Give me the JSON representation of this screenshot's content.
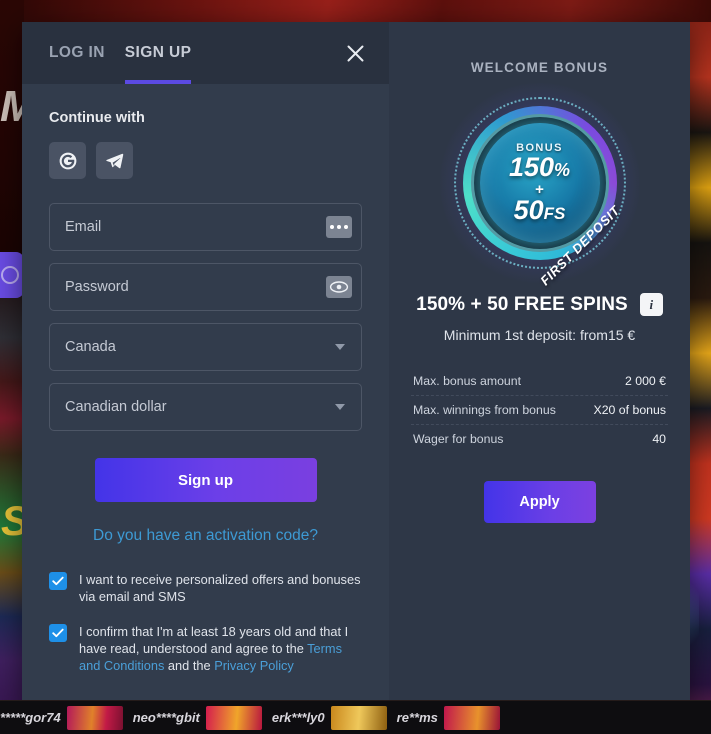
{
  "modal": {
    "tabs": [
      {
        "label": "LOG IN",
        "active": false
      },
      {
        "label": "SIGN UP",
        "active": true
      }
    ],
    "close_icon": "close-icon"
  },
  "form": {
    "continue_with_label": "Continue with",
    "social_buttons": [
      {
        "name": "google-icon",
        "label": "Google"
      },
      {
        "name": "telegram-icon",
        "label": "Telegram"
      }
    ],
    "fields": [
      {
        "name": "email-field",
        "placeholder": "Email",
        "value": "",
        "adornment": "autofill-dots-icon"
      },
      {
        "name": "password-field",
        "placeholder": "Password",
        "value": "",
        "adornment": "reveal-password-icon"
      }
    ],
    "selects": [
      {
        "name": "country-select",
        "value": "Canada"
      },
      {
        "name": "currency-select",
        "value": "Canadian dollar"
      }
    ],
    "submit_label": "Sign up",
    "activation_link": "Do you have an activation code?",
    "checkboxes": [
      {
        "checked": true,
        "text": "I want to receive personalized offers and bonuses via email and SMS"
      },
      {
        "checked": true,
        "text_part1": "I confirm that I'm at least 18 years old and that I have read, understood and agree to the ",
        "link1": "Terms and Conditions",
        "text_part2": " and the ",
        "link2": "Privacy Policy"
      }
    ]
  },
  "bonus": {
    "kicker": "WELCOME BONUS",
    "badge": {
      "bonus_word": "BONUS",
      "percent": "150",
      "percent_symbol": "%",
      "plus": "+",
      "spins": "50",
      "spins_unit": "FS",
      "ribbon": "FIRST DEPOSIT"
    },
    "title": "150% + 50 FREE SPINS",
    "info_icon_label": "i",
    "subtitle": "Minimum 1st deposit: from15 €",
    "details": [
      {
        "label": "Max. bonus amount",
        "value": "2 000 €"
      },
      {
        "label": "Max. winnings from bonus",
        "value": "X20 of bonus"
      },
      {
        "label": "Wager for bonus",
        "value": "40"
      }
    ],
    "apply_label": "Apply"
  },
  "background": {
    "brand_mark_left": "M",
    "brand_mark_lower": "S",
    "ticker": [
      {
        "name": "*****gor74"
      },
      {
        "name": "neo****gbit"
      },
      {
        "name": "erk***ly0"
      },
      {
        "name": "re**ms"
      }
    ]
  },
  "colors": {
    "accent_purple": "#5b4ae2",
    "button_gradient_start": "#4334e8",
    "button_gradient_end": "#7a3fe0",
    "checkbox_blue": "#1e90e8",
    "link_blue": "#3d9ad4",
    "panel_left": "#323c4c",
    "panel_right": "#2e3747",
    "header_dark": "#29313f"
  }
}
